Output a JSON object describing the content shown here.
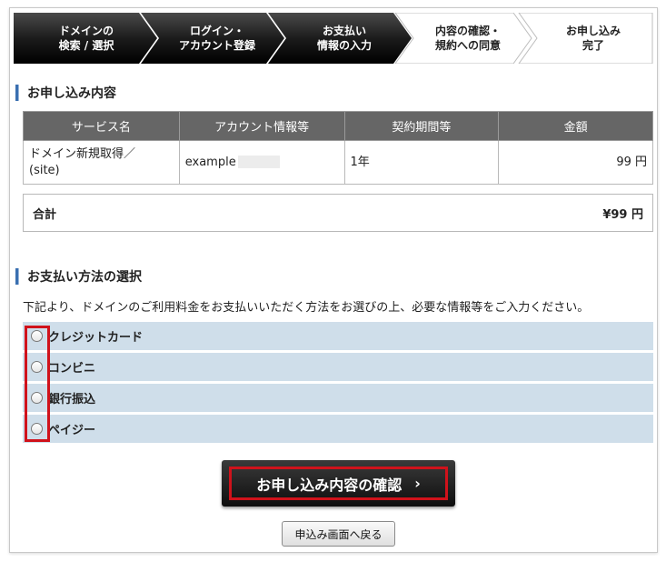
{
  "steps": [
    {
      "line1": "ドメインの",
      "line2": "検索 / 選択",
      "state": "done"
    },
    {
      "line1": "ログイン・",
      "line2": "アカウント登録",
      "state": "done"
    },
    {
      "line1": "お支払い",
      "line2": "情報の入力",
      "state": "current"
    },
    {
      "line1": "内容の確認・",
      "line2": "規約への同意",
      "state": "todo"
    },
    {
      "line1": "お申し込み",
      "line2": "完了",
      "state": "todo"
    }
  ],
  "order": {
    "title": "お申し込み内容",
    "headers": [
      "サービス名",
      "アカウント情報等",
      "契約期間等",
      "金額"
    ],
    "row": {
      "service_line1": "ドメイン新規取得／",
      "service_line2": "(site)",
      "account": "example",
      "period": "1年",
      "amount": "99 円"
    },
    "total_label": "合計",
    "total_value": "¥99 円"
  },
  "payment": {
    "title": "お支払い方法の選択",
    "description": "下記より、ドメインのご利用料金をお支払いいただく方法をお選びの上、必要な情報等をご入力ください。",
    "options": [
      "クレジットカード",
      "コンビニ",
      "銀行振込",
      "ペイジー"
    ]
  },
  "actions": {
    "confirm_label": "お申し込み内容の確認",
    "confirm_chevron": "›",
    "back_label": "申込み画面へ戻る"
  },
  "colors": {
    "step_dark": "#111111",
    "accent_bar": "#3a6fb0",
    "option_bg": "#cfdeea",
    "highlight": "#d0121b"
  }
}
